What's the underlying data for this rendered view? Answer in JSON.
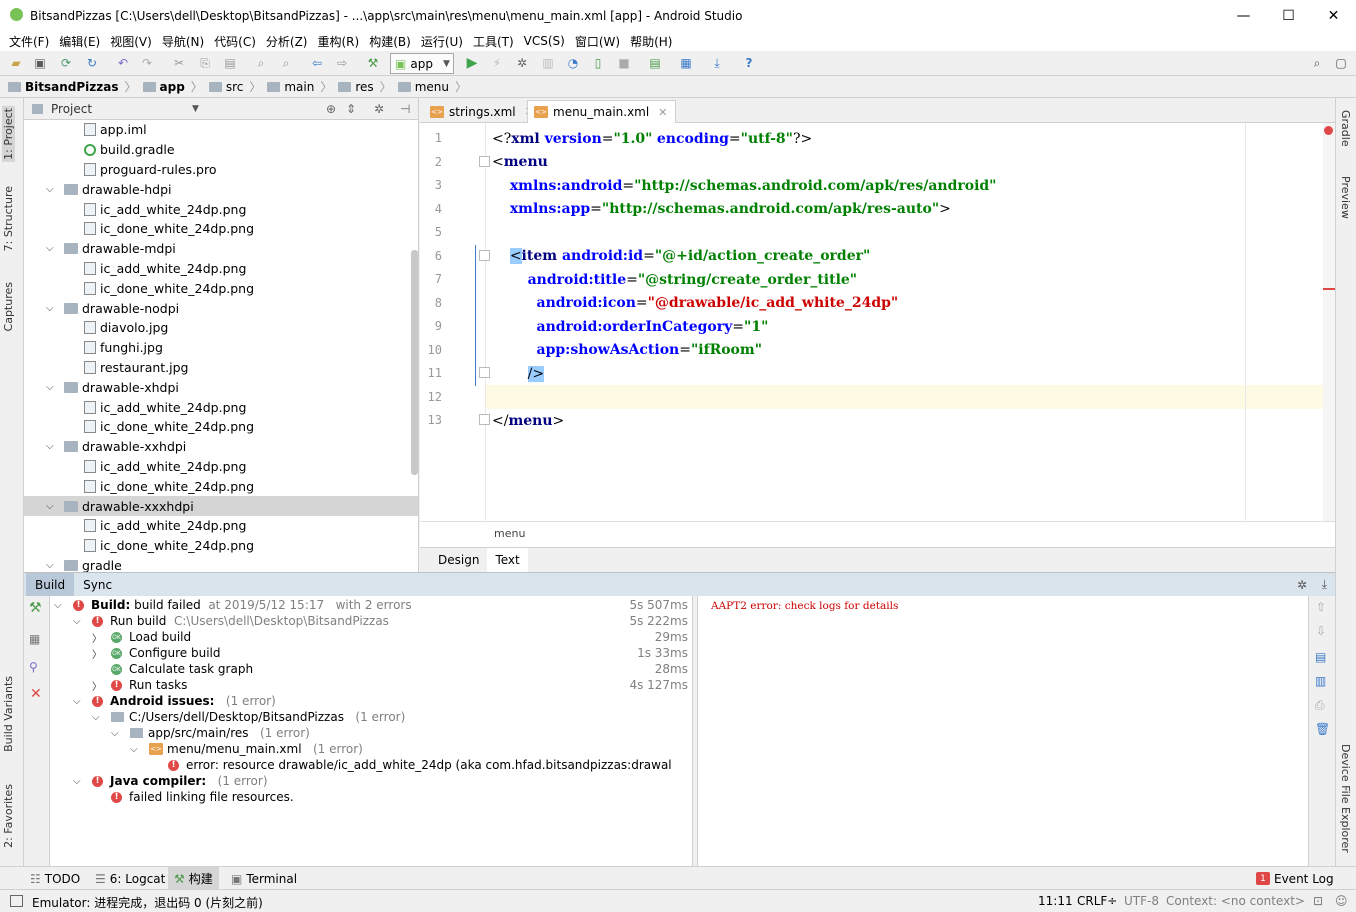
{
  "window": {
    "title": "BitsandPizzas [C:\\Users\\dell\\Desktop\\BitsandPizzas] - ...\\app\\src\\main\\res\\menu\\menu_main.xml [app] - Android Studio",
    "minimize": "—",
    "maximize": "☐",
    "close": "✕"
  },
  "menubar": [
    "文件(F)",
    "编辑(E)",
    "视图(V)",
    "导航(N)",
    "代码(C)",
    "分析(Z)",
    "重构(R)",
    "构建(B)",
    "运行(U)",
    "工具(T)",
    "VCS(S)",
    "窗口(W)",
    "帮助(H)"
  ],
  "toolbar": {
    "run_config": "app"
  },
  "breadcrumbs": [
    "BitsandPizzas",
    "app",
    "src",
    "main",
    "res",
    "menu"
  ],
  "side_tabs": {
    "left": [
      "1: Project",
      "7: Structure",
      "Captures",
      "Build Variants",
      "2: Favorites"
    ],
    "right": [
      "Gradle",
      "Preview",
      "Device File Explorer"
    ]
  },
  "project_panel": {
    "title": "Project",
    "tree": [
      {
        "label": "app.iml",
        "kind": "file",
        "indent": 3
      },
      {
        "label": "build.gradle",
        "kind": "gradle",
        "indent": 3
      },
      {
        "label": "proguard-rules.pro",
        "kind": "file",
        "indent": 3
      },
      {
        "label": "drawable-hdpi",
        "kind": "folder",
        "indent": 2,
        "expanded": true
      },
      {
        "label": "ic_add_white_24dp.png",
        "kind": "file",
        "indent": 3
      },
      {
        "label": "ic_done_white_24dp.png",
        "kind": "file",
        "indent": 3
      },
      {
        "label": "drawable-mdpi",
        "kind": "folder",
        "indent": 2,
        "expanded": true
      },
      {
        "label": "ic_add_white_24dp.png",
        "kind": "file",
        "indent": 3
      },
      {
        "label": "ic_done_white_24dp.png",
        "kind": "file",
        "indent": 3
      },
      {
        "label": "drawable-nodpi",
        "kind": "folder",
        "indent": 2,
        "expanded": true
      },
      {
        "label": "diavolo.jpg",
        "kind": "file",
        "indent": 3
      },
      {
        "label": "funghi.jpg",
        "kind": "file",
        "indent": 3
      },
      {
        "label": "restaurant.jpg",
        "kind": "file",
        "indent": 3
      },
      {
        "label": "drawable-xhdpi",
        "kind": "folder",
        "indent": 2,
        "expanded": true
      },
      {
        "label": "ic_add_white_24dp.png",
        "kind": "file",
        "indent": 3
      },
      {
        "label": "ic_done_white_24dp.png",
        "kind": "file",
        "indent": 3
      },
      {
        "label": "drawable-xxhdpi",
        "kind": "folder",
        "indent": 2,
        "expanded": true
      },
      {
        "label": "ic_add_white_24dp.png",
        "kind": "file",
        "indent": 3
      },
      {
        "label": "ic_done_white_24dp.png",
        "kind": "file",
        "indent": 3
      },
      {
        "label": "drawable-xxxhdpi",
        "kind": "folder",
        "indent": 2,
        "expanded": true,
        "selected": true
      },
      {
        "label": "ic_add_white_24dp.png",
        "kind": "file",
        "indent": 3
      },
      {
        "label": "ic_done_white_24dp.png",
        "kind": "file",
        "indent": 3
      },
      {
        "label": "gradle",
        "kind": "folder",
        "indent": 2,
        "expanded": true
      }
    ]
  },
  "editor": {
    "tabs": [
      {
        "label": "strings.xml",
        "active": false
      },
      {
        "label": "menu_main.xml",
        "active": true
      }
    ],
    "line_numbers": [
      "1",
      "2",
      "3",
      "4",
      "5",
      "6",
      "7",
      "8",
      "9",
      "10",
      "11",
      "12",
      "13"
    ],
    "breadcrumb": "menu",
    "design_tabs": [
      "Design",
      "Text"
    ],
    "lines": [
      [
        {
          "t": "<?",
          "c": "punc"
        },
        {
          "t": "xml ",
          "c": "tag"
        },
        {
          "t": "version",
          "c": "attr"
        },
        {
          "t": "=",
          "c": "punc"
        },
        {
          "t": "\"1.0\"",
          "c": "aval"
        },
        {
          "t": " ",
          "c": "punc"
        },
        {
          "t": "encoding",
          "c": "attr"
        },
        {
          "t": "=",
          "c": "punc"
        },
        {
          "t": "\"utf-8\"",
          "c": "aval"
        },
        {
          "t": "?>",
          "c": "punc"
        }
      ],
      [
        {
          "t": "<",
          "c": "punc"
        },
        {
          "t": "menu",
          "c": "tag"
        }
      ],
      [
        {
          "t": "    ",
          "c": "punc"
        },
        {
          "t": "xmlns:android",
          "c": "attr"
        },
        {
          "t": "=",
          "c": "punc"
        },
        {
          "t": "\"http://schemas.android.com/apk/res/android\"",
          "c": "aval"
        }
      ],
      [
        {
          "t": "    ",
          "c": "punc"
        },
        {
          "t": "xmlns:app",
          "c": "attr"
        },
        {
          "t": "=",
          "c": "punc"
        },
        {
          "t": "\"http://schemas.android.com/apk/res-auto\"",
          "c": "aval"
        },
        {
          "t": ">",
          "c": "punc"
        }
      ],
      [],
      [
        {
          "t": "    ",
          "c": "punc"
        },
        {
          "t": "<",
          "c": "bracehl"
        },
        {
          "t": "item ",
          "c": "tag"
        },
        {
          "t": "android:id",
          "c": "attr"
        },
        {
          "t": "=",
          "c": "punc"
        },
        {
          "t": "\"@+id/action_create_order\"",
          "c": "aval"
        }
      ],
      [
        {
          "t": "        ",
          "c": "punc"
        },
        {
          "t": "android:title",
          "c": "attr"
        },
        {
          "t": "=",
          "c": "punc"
        },
        {
          "t": "\"@string/create_order_title\"",
          "c": "aval"
        }
      ],
      [
        {
          "t": "          ",
          "c": "punc"
        },
        {
          "t": "android:icon",
          "c": "attr"
        },
        {
          "t": "=",
          "c": "punc"
        },
        {
          "t": "\"@drawable/ic_add_white_24dp\"",
          "c": "aval-r"
        }
      ],
      [
        {
          "t": "          ",
          "c": "punc"
        },
        {
          "t": "android:orderInCategory",
          "c": "attr"
        },
        {
          "t": "=",
          "c": "punc"
        },
        {
          "t": "\"1\"",
          "c": "aval"
        }
      ],
      [
        {
          "t": "          ",
          "c": "punc"
        },
        {
          "t": "app:showAsAction",
          "c": "attr"
        },
        {
          "t": "=",
          "c": "punc"
        },
        {
          "t": "\"ifRoom\"",
          "c": "aval"
        }
      ],
      [
        {
          "t": "        ",
          "c": "punc"
        },
        {
          "t": "/>",
          "c": "bracehl"
        }
      ],
      [],
      [
        {
          "t": "</",
          "c": "punc"
        },
        {
          "t": "menu",
          "c": "tag"
        },
        {
          "t": ">",
          "c": "punc"
        }
      ]
    ]
  },
  "build": {
    "tabs": [
      "Build",
      "Sync"
    ],
    "rows": [
      {
        "indent": 0,
        "chev": "v",
        "status": "error",
        "bold": "Build:",
        "text": " build failed",
        "extra": "  at 2019/5/12 15:17   with 2 errors",
        "time": "5s 507ms"
      },
      {
        "indent": 1,
        "chev": "v",
        "status": "error",
        "bold": "",
        "text": "Run build",
        "extra": "  C:\\Users\\dell\\Desktop\\BitsandPizzas",
        "time": "5s 222ms"
      },
      {
        "indent": 2,
        "chev": ">",
        "status": "ok",
        "bold": "",
        "text": "Load build",
        "extra": "",
        "time": "29ms"
      },
      {
        "indent": 2,
        "chev": ">",
        "status": "ok",
        "bold": "",
        "text": "Configure build",
        "extra": "",
        "time": "1s 33ms"
      },
      {
        "indent": 2,
        "chev": "",
        "status": "ok",
        "bold": "",
        "text": "Calculate task graph",
        "extra": "",
        "time": "28ms"
      },
      {
        "indent": 2,
        "chev": ">",
        "status": "error",
        "bold": "",
        "text": "Run tasks",
        "extra": "",
        "time": "4s 127ms"
      },
      {
        "indent": 1,
        "chev": "v",
        "status": "error",
        "bold": "Android issues:",
        "text": "",
        "extra": "   (1 error)",
        "time": ""
      },
      {
        "indent": 2,
        "chev": "v",
        "status": "folder",
        "bold": "",
        "text": "C:/Users/dell/Desktop/BitsandPizzas",
        "extra": "   (1 error)",
        "time": ""
      },
      {
        "indent": 3,
        "chev": "v",
        "status": "folder",
        "bold": "",
        "text": "app/src/main/res",
        "extra": "   (1 error)",
        "time": ""
      },
      {
        "indent": 4,
        "chev": "v",
        "status": "xml",
        "bold": "",
        "text": "menu/menu_main.xml",
        "extra": "   (1 error)",
        "time": ""
      },
      {
        "indent": 5,
        "chev": "",
        "status": "error",
        "bold": "",
        "text": "error: resource drawable/ic_add_white_24dp (aka com.hfad.bitsandpizzas:drawal",
        "extra": "",
        "time": ""
      },
      {
        "indent": 1,
        "chev": "v",
        "status": "error",
        "bold": "Java compiler:",
        "text": "",
        "extra": "   (1 error)",
        "time": ""
      },
      {
        "indent": 2,
        "chev": "",
        "status": "error",
        "bold": "",
        "text": "failed linking file resources.",
        "extra": "",
        "time": ""
      }
    ],
    "output": "AAPT2 error: check logs for details"
  },
  "bottom_tabs": {
    "todo": "TODO",
    "logcat": "6: Logcat",
    "build": "构建",
    "terminal": "Terminal",
    "event_log": "Event Log",
    "event_count": "1"
  },
  "status": {
    "message": "Emulator: 进程完成，退出码 0 (片刻之前)",
    "position": "11:11",
    "line_sep": "CRLF÷",
    "encoding": "UTF-8",
    "context": "Context: <no context>"
  }
}
